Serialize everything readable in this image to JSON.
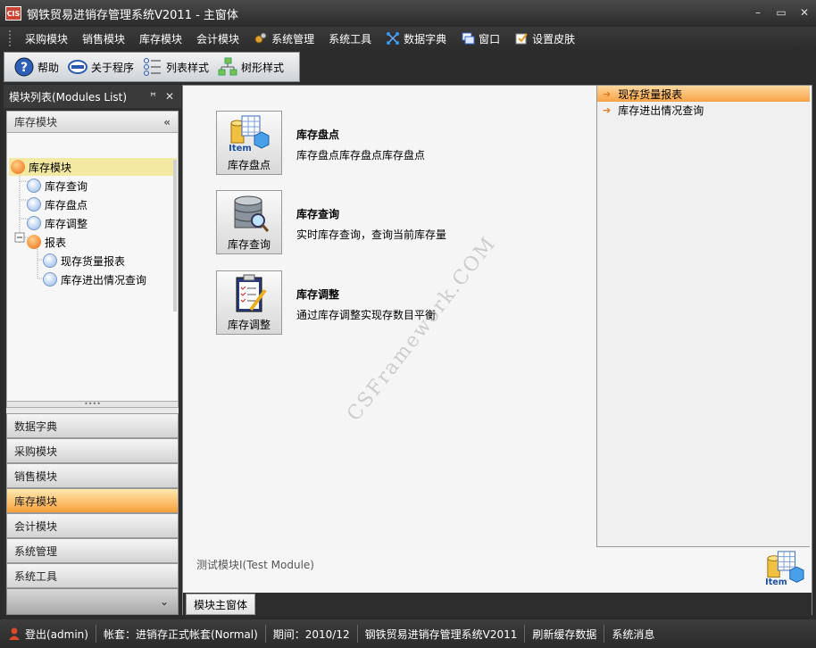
{
  "window": {
    "app_icon": "CIS",
    "title": "钢铁贸易进销存管理系统V2011 - 主窗体",
    "min_glyph": "–",
    "max_glyph": "▭",
    "close_glyph": "✕"
  },
  "menu": [
    {
      "label": "采购模块",
      "icon": ""
    },
    {
      "label": "销售模块",
      "icon": ""
    },
    {
      "label": "库存模块",
      "icon": ""
    },
    {
      "label": "会计模块",
      "icon": ""
    },
    {
      "label": "系统管理",
      "icon": "gears-icon"
    },
    {
      "label": "系统工具",
      "icon": ""
    },
    {
      "label": "数据字典",
      "icon": "network-icon"
    },
    {
      "label": "窗口",
      "icon": "windows-icon"
    },
    {
      "label": "设置皮肤",
      "icon": "skin-icon"
    }
  ],
  "toolbar": {
    "help": "帮助",
    "about": "关于程序",
    "list_style": "列表样式",
    "tree_style": "树形样式"
  },
  "left_panel": {
    "title": "模块列表(Modules List)",
    "pin_glyph": "ꟸ",
    "close_glyph": "✕",
    "group_title": "库存模块",
    "collapse_glyph": "«",
    "tree": [
      {
        "label": "库存模块"
      },
      {
        "label": "库存查询"
      },
      {
        "label": "库存盘点"
      },
      {
        "label": "库存调整"
      },
      {
        "label": "报表"
      },
      {
        "label": "现存货量报表"
      },
      {
        "label": "库存进出情况查询"
      }
    ],
    "splitter_glyph": "••••",
    "nav_buttons": [
      "数据字典",
      "采购模块",
      "销售模块",
      "库存模块",
      "会计模块",
      "系统管理",
      "系统工具"
    ],
    "active_nav": "库存模块",
    "footer_glyph": "⌄"
  },
  "main": {
    "tiles": [
      {
        "button_label": "库存盘点",
        "title": "库存盘点",
        "desc": "库存盘点库存盘点库存盘点",
        "icon": "item-database-icon"
      },
      {
        "button_label": "库存查询",
        "title": "库存查询",
        "desc": "实时库存查询，查询当前库存量",
        "icon": "database-search-icon"
      },
      {
        "button_label": "库存调整",
        "title": "库存调整",
        "desc": "通过库存调整实现存数目平衡",
        "icon": "clipboard-icon"
      }
    ],
    "watermark": "CSFramework.COM",
    "reports": [
      "现存货量报表",
      "库存进出情况查询"
    ],
    "report_arrow": "➔",
    "test_module": "测试模块I(Test Module)",
    "tab_label": "模块主窗体"
  },
  "status": {
    "login": "登出(admin)",
    "account": "帐套：进销存正式帐套(Normal)",
    "period": "期间：2010/12",
    "system": "钢铁贸易进销存管理系统V2011",
    "refresh": "刷新缓存数据",
    "messages": "系统消息"
  },
  "colors": {
    "accent_orange": "#f6a245",
    "selection_yellow": "#f4e9a2",
    "dark_chrome": "#2c2c2c"
  }
}
